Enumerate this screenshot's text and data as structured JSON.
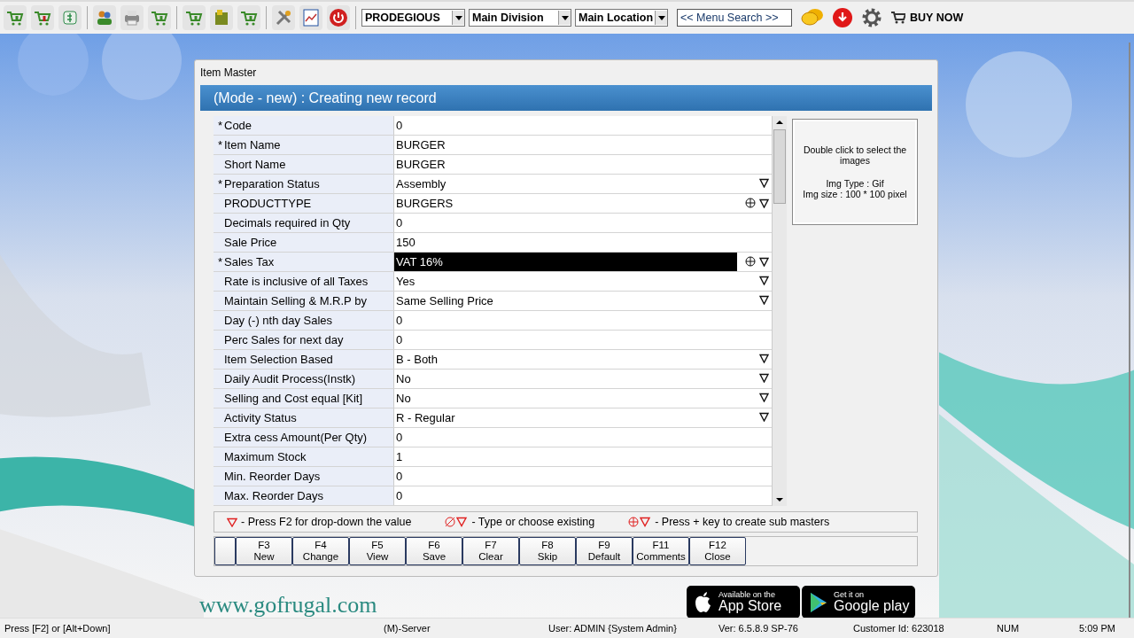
{
  "toolbar": {
    "company": "PRODEGIOUS",
    "division": "Main Division",
    "location": "Main Location",
    "search": {
      "placeholder": "<< Menu Search >>"
    },
    "buy_now": "BUY NOW"
  },
  "background": {
    "website": "www.gofrugal.com",
    "badges": [
      {
        "kind": "apple",
        "small": "Available on the",
        "big": "App Store"
      },
      {
        "kind": "play",
        "small": "Get it on",
        "big": "Google play"
      }
    ]
  },
  "dialog": {
    "title": "Item Master",
    "header": "(Mode - new) : Creating new record",
    "rows": [
      {
        "mark": "*",
        "label": "Code",
        "value": "0",
        "kind": "text",
        "selected": false
      },
      {
        "mark": "*",
        "label": "Item Name",
        "value": "BURGER",
        "kind": "text",
        "selected": false
      },
      {
        "label": "Short Name",
        "value": "BURGER",
        "kind": "text",
        "selected": false
      },
      {
        "mark": "*",
        "label": "Preparation Status",
        "value": "Assembly",
        "kind": "dropdown",
        "selected": false
      },
      {
        "label": "PRODUCTTYPE",
        "value": "BURGERS",
        "kind": "lookup",
        "selected": false
      },
      {
        "label": "Decimals required in Qty",
        "value": "0",
        "kind": "text",
        "selected": false
      },
      {
        "label": "Sale Price",
        "value": "150",
        "kind": "text",
        "selected": false
      },
      {
        "mark": "*",
        "label": "Sales Tax",
        "value": "VAT 16%",
        "kind": "lookup",
        "selected": true
      },
      {
        "label": "Rate is inclusive of all Taxes",
        "value": "Yes",
        "kind": "dropdown",
        "selected": false
      },
      {
        "label": "Maintain Selling & M.R.P by",
        "value": "Same Selling Price",
        "kind": "dropdown",
        "selected": false
      },
      {
        "label": "Day (-) nth day Sales",
        "value": "0",
        "kind": "text",
        "selected": false
      },
      {
        "label": "Perc Sales for next day",
        "value": "0",
        "kind": "text",
        "selected": false
      },
      {
        "label": "Item Selection Based",
        "value": "B - Both",
        "kind": "dropdown",
        "selected": false
      },
      {
        "label": "Daily Audit Process(Instk)",
        "value": "No",
        "kind": "dropdown",
        "selected": false
      },
      {
        "label": "Selling and Cost equal [Kit]",
        "value": "No",
        "kind": "dropdown",
        "selected": false
      },
      {
        "label": "Activity Status",
        "value": "R - Regular",
        "kind": "dropdown",
        "selected": false
      },
      {
        "label": "Extra cess Amount(Per Qty)",
        "value": "0",
        "kind": "text",
        "selected": false
      },
      {
        "label": "Maximum Stock",
        "value": "1",
        "kind": "text",
        "selected": false
      },
      {
        "label": "Min. Reorder Days",
        "value": "0",
        "kind": "text",
        "selected": false
      },
      {
        "label": "Max. Reorder Days",
        "value": "0",
        "kind": "text",
        "selected": false
      }
    ],
    "image_box": {
      "hint": "Double click to select the images",
      "type": "Img Type : Gif",
      "size": "Img size : 100 * 100 pixel"
    },
    "legend": [
      {
        "kind": "dropdown",
        "text": "- Press F2 for drop-down the value"
      },
      {
        "kind": "typeahead",
        "text": "- Type or choose existing"
      },
      {
        "kind": "lookup",
        "text": "- Press + key to create sub masters"
      }
    ],
    "keys": [
      {
        "key": "F3",
        "label": "New"
      },
      {
        "key": "F4",
        "label": "Change"
      },
      {
        "key": "F5",
        "label": "View"
      },
      {
        "key": "F6",
        "label": "Save"
      },
      {
        "key": "F7",
        "label": "Clear"
      },
      {
        "key": "F8",
        "label": "Skip"
      },
      {
        "key": "F9",
        "label": "Default"
      },
      {
        "key": "F11",
        "label": "Comments"
      },
      {
        "key": "F12",
        "label": "Close"
      }
    ]
  },
  "status_bar": {
    "hint": "Press [F2] or [Alt+Down]",
    "server": "(M)-Server",
    "user": "User: ADMIN {System Admin}",
    "version": "Ver: 6.5.8.9 SP-76",
    "customer": "Customer Id: 623018",
    "num": "NUM",
    "time": "5:09 PM"
  }
}
